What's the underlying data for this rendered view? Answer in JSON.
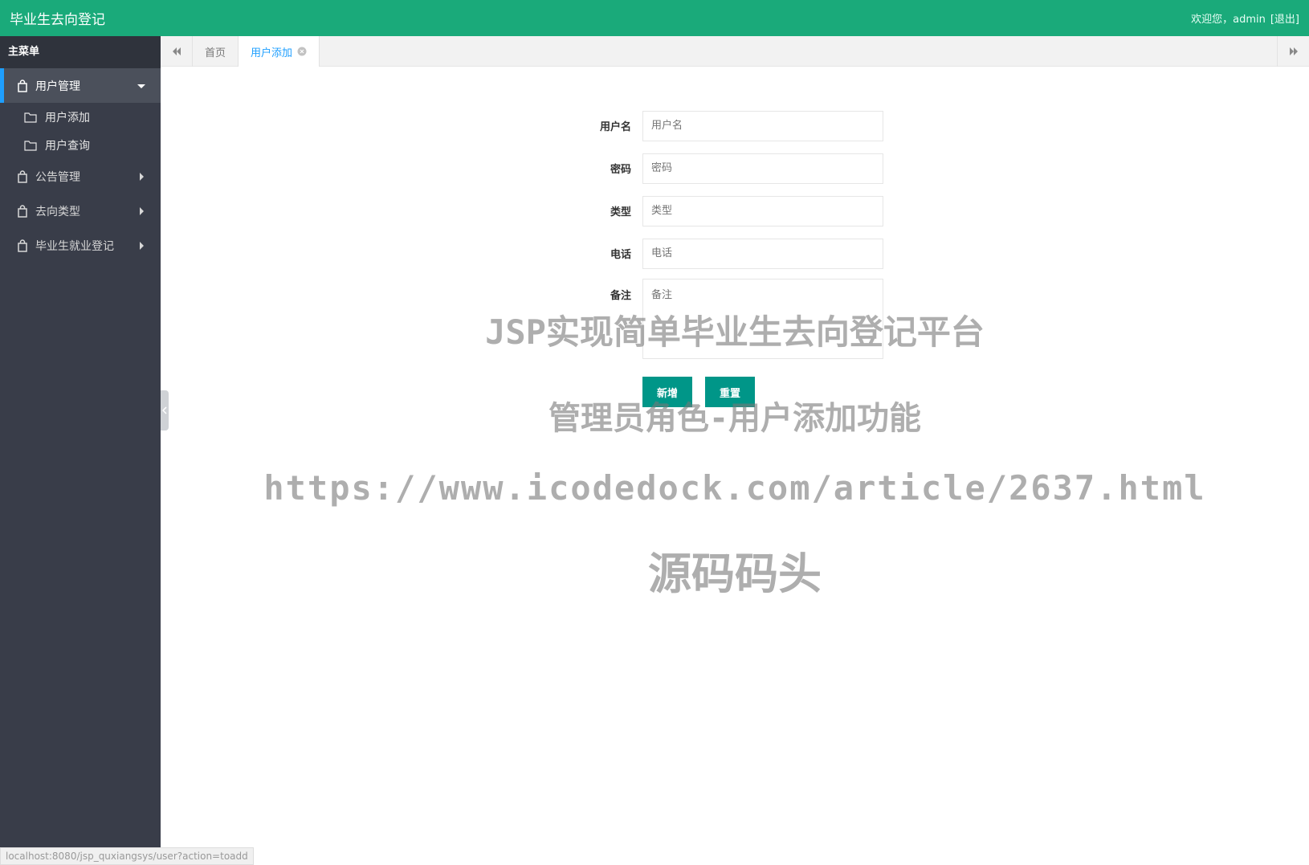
{
  "header": {
    "app_title": "毕业生去向登记",
    "welcome_text": "欢迎您，admin",
    "logout_label": "[退出]"
  },
  "sidebar": {
    "title": "主菜单",
    "groups": [
      {
        "label": "用户管理",
        "icon": "bag-icon",
        "expanded": true,
        "items": [
          {
            "label": "用户添加",
            "icon": "folder-icon"
          },
          {
            "label": "用户查询",
            "icon": "folder-icon"
          }
        ]
      },
      {
        "label": "公告管理",
        "icon": "bag-icon",
        "expanded": false
      },
      {
        "label": "去向类型",
        "icon": "bag-icon",
        "expanded": false
      },
      {
        "label": "毕业生就业登记",
        "icon": "bag-icon",
        "expanded": false
      }
    ]
  },
  "tabs": [
    {
      "label": "首页",
      "active": false
    },
    {
      "label": "用户添加",
      "active": true
    }
  ],
  "form": {
    "username": {
      "label": "用户名",
      "placeholder": "用户名",
      "value": ""
    },
    "password": {
      "label": "密码",
      "placeholder": "密码",
      "value": ""
    },
    "type": {
      "label": "类型",
      "placeholder": "类型",
      "value": ""
    },
    "phone": {
      "label": "电话",
      "placeholder": "电话",
      "value": ""
    },
    "remark": {
      "label": "备注",
      "placeholder": "备注",
      "value": ""
    },
    "submit_label": "新增",
    "reset_label": "重置"
  },
  "watermark": {
    "line1": "JSP实现简单毕业生去向登记平台",
    "line2": "管理员角色-用户添加功能",
    "line3": "https://www.icodedock.com/article/2637.html",
    "line4": "源码码头"
  },
  "status_url": "localhost:8080/jsp_quxiangsys/user?action=toadd",
  "colors": {
    "topbar": "#1aaa7a",
    "sidebar": "#393d49",
    "accent": "#1e9fff",
    "button": "#009688"
  }
}
